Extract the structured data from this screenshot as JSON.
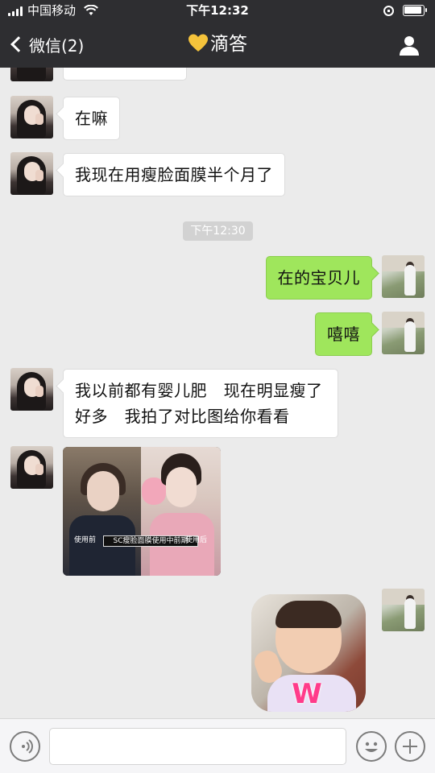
{
  "status_bar": {
    "carrier": "中国移动",
    "time": "下午12:32"
  },
  "nav": {
    "back_label": "微信(2)",
    "title": "滴答",
    "title_icon": "yellow-heart-icon",
    "right_icon": "person-icon"
  },
  "messages": [
    {
      "side": "left",
      "type": "text",
      "text": "在嘛"
    },
    {
      "side": "left",
      "type": "text",
      "text": "我现在用瘦脸面膜半个月了"
    },
    {
      "type": "time",
      "text": "下午12:30"
    },
    {
      "side": "right",
      "type": "text",
      "text": "在的宝贝儿"
    },
    {
      "side": "right",
      "type": "text",
      "text": "嘻嘻"
    },
    {
      "side": "left",
      "type": "text",
      "lines": [
        "我以前都有婴儿肥   现在明显瘦了",
        "好多   我拍了对比图给你看看"
      ]
    },
    {
      "side": "left",
      "type": "image",
      "captions": {
        "before": "使用前",
        "middle": "SC瘦脸面膜使用中前期",
        "after": "使用后"
      }
    },
    {
      "side": "right",
      "type": "sticker",
      "sticker_text": "W"
    }
  ],
  "input_bar": {
    "voice_icon": "voice-icon",
    "emoji_icon": "emoji-icon",
    "plus_icon": "plus-icon"
  },
  "colors": {
    "nav_background": "#2e2e31",
    "chat_background": "#ebebeb",
    "outgoing_bubble": "#9fe65c",
    "incoming_bubble": "#ffffff"
  }
}
